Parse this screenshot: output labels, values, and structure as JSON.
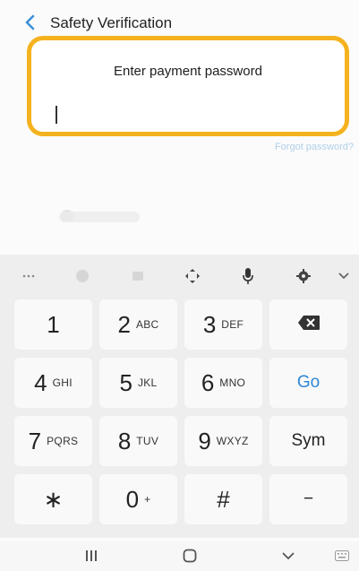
{
  "header": {
    "title": "Safety Verification"
  },
  "card": {
    "label": "Enter payment password"
  },
  "forgot_link": "Forgot password?",
  "toolbar": {
    "icons": [
      "more-icon",
      "emoji-icon",
      "clipboard-icon",
      "cursor-move-icon",
      "microphone-icon",
      "settings-icon",
      "collapse-icon"
    ]
  },
  "keys": [
    {
      "main": "1",
      "sub": ""
    },
    {
      "main": "2",
      "sub": "ABC"
    },
    {
      "main": "3",
      "sub": "DEF"
    },
    {
      "type": "backspace"
    },
    {
      "main": "4",
      "sub": "GHI"
    },
    {
      "main": "5",
      "sub": "JKL"
    },
    {
      "main": "6",
      "sub": "MNO"
    },
    {
      "type": "go",
      "label": "Go"
    },
    {
      "main": "7",
      "sub": "PQRS"
    },
    {
      "main": "8",
      "sub": "TUV"
    },
    {
      "main": "9",
      "sub": "WXYZ"
    },
    {
      "type": "sym",
      "label": "Sym"
    },
    {
      "main": "∗",
      "sub": ""
    },
    {
      "main": "0",
      "sub": "+"
    },
    {
      "main": "#",
      "sub": ""
    },
    {
      "type": "minus",
      "label": "−"
    }
  ],
  "navbar": {
    "icons": [
      "recent-apps-icon",
      "home-icon",
      "back-down-icon",
      "keyboard-icon"
    ]
  },
  "colors": {
    "accent_border": "#f4b21e",
    "go_blue": "#2e86d6",
    "back_blue": "#3d8fd6"
  }
}
